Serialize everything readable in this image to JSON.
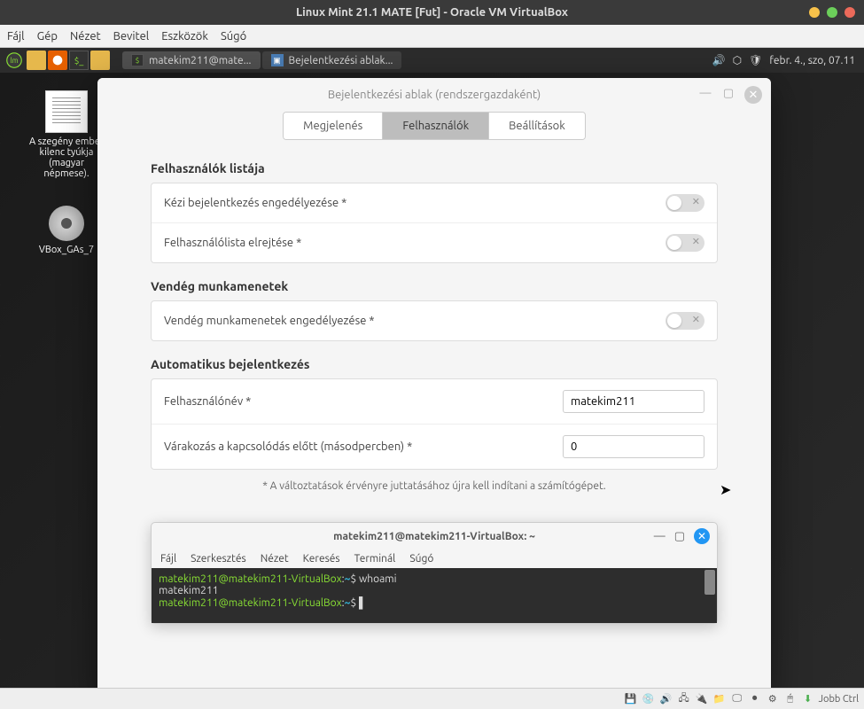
{
  "virtualbox": {
    "title": "Linux Mint 21.1 MATE [Fut] - Oracle VM VirtualBox",
    "menu": [
      "Fájl",
      "Gép",
      "Nézet",
      "Bevitel",
      "Eszközök",
      "Súgó"
    ],
    "status_right": "Jobb Ctrl"
  },
  "mint_panel": {
    "task1": "matekim211@mate...",
    "task2": "Bejelentkezési ablak...",
    "clock": "febr. 4., szo, 07.11"
  },
  "desktop_icons": {
    "doc_label": "A szegény ember kilenc tyúkja (magyar népmese).",
    "vbox_label": "VBox_GAs_7"
  },
  "settings_window": {
    "title": "Bejelentkezési ablak (rendszergazdaként)",
    "tabs": {
      "appearance": "Megjelenés",
      "users": "Felhasználók",
      "settings": "Beállítások"
    },
    "sections": {
      "userlist": {
        "title": "Felhasználók listája",
        "manual_login": "Kézi bejelentkezés engedélyezése *",
        "hide_userlist": "Felhasználólista elrejtése *"
      },
      "guest": {
        "title": "Vendég munkamenetek",
        "allow_guest": "Vendég munkamenetek engedélyezése *"
      },
      "autologin": {
        "title": "Automatikus bejelentkezés",
        "username_label": "Felhasználónév *",
        "username_value": "matekim211",
        "delay_label": "Várakozás a kapcsolódás előtt (másodpercben) *",
        "delay_value": "0"
      }
    },
    "footnote": "* A változtatások érvényre juttatásához újra kell indítani a számítógépet."
  },
  "terminal": {
    "title": "matekim211@matekim211-VirtualBox: ~",
    "menu": [
      "Fájl",
      "Szerkesztés",
      "Nézet",
      "Keresés",
      "Terminál",
      "Súgó"
    ],
    "prompt_user": "matekim211@matekim211-VirtualBox",
    "prompt_path": "~",
    "cmd1": "whoami",
    "out1": "matekim211"
  }
}
